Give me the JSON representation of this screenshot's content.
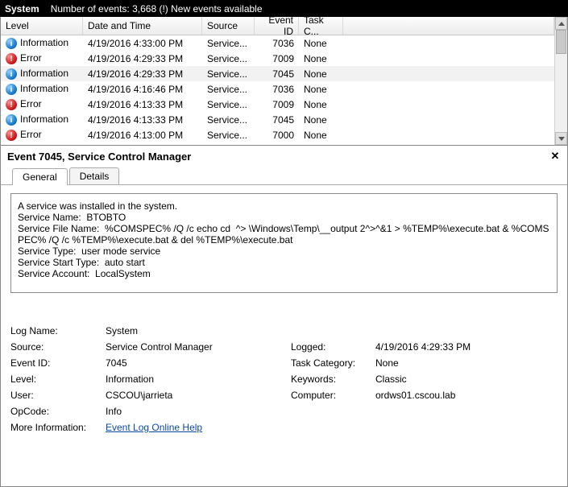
{
  "titlebar": {
    "title": "System",
    "right": "Number of events: 3,668 (!) New events available"
  },
  "columns": {
    "level": "Level",
    "datetime": "Date and Time",
    "source": "Source",
    "event_id": "Event ID",
    "task": "Task C..."
  },
  "events": [
    {
      "level": "Information",
      "icon": "info",
      "datetime": "4/19/2016 4:33:00 PM",
      "source": "Service...",
      "event_id": "7036",
      "task": "None",
      "selected": false
    },
    {
      "level": "Error",
      "icon": "err",
      "datetime": "4/19/2016 4:29:33 PM",
      "source": "Service...",
      "event_id": "7009",
      "task": "None",
      "selected": false
    },
    {
      "level": "Information",
      "icon": "info",
      "datetime": "4/19/2016 4:29:33 PM",
      "source": "Service...",
      "event_id": "7045",
      "task": "None",
      "selected": true
    },
    {
      "level": "Information",
      "icon": "info",
      "datetime": "4/19/2016 4:16:46 PM",
      "source": "Service...",
      "event_id": "7036",
      "task": "None",
      "selected": false
    },
    {
      "level": "Error",
      "icon": "err",
      "datetime": "4/19/2016 4:13:33 PM",
      "source": "Service...",
      "event_id": "7009",
      "task": "None",
      "selected": false
    },
    {
      "level": "Information",
      "icon": "info",
      "datetime": "4/19/2016 4:13:33 PM",
      "source": "Service...",
      "event_id": "7045",
      "task": "None",
      "selected": false
    },
    {
      "level": "Error",
      "icon": "err",
      "datetime": "4/19/2016 4:13:00 PM",
      "source": "Service...",
      "event_id": "7000",
      "task": "None",
      "selected": false
    }
  ],
  "detail": {
    "header": "Event 7045, Service Control Manager",
    "tabs": {
      "general": "General",
      "details": "Details"
    },
    "body_lines": [
      "A service was installed in the system.",
      "",
      "Service Name:  BTOBTO",
      "Service File Name:  %COMSPEC% /Q /c echo cd  ^> \\Windows\\Temp\\__output 2^>^&1 > %TEMP%\\execute.bat & %COMSPEC% /Q /c %TEMP%\\execute.bat & del %TEMP%\\execute.bat",
      "Service Type:  user mode service",
      "Service Start Type:  auto start",
      "Service Account:  LocalSystem"
    ],
    "labels": {
      "log_name": "Log Name:",
      "source": "Source:",
      "event_id": "Event ID:",
      "level": "Level:",
      "user": "User:",
      "opcode": "OpCode:",
      "logged": "Logged:",
      "task_category": "Task Category:",
      "keywords": "Keywords:",
      "computer": "Computer:",
      "more_info": "More Information:"
    },
    "values": {
      "log_name": "System",
      "source": "Service Control Manager",
      "event_id": "7045",
      "level": "Information",
      "user": "CSCOU\\jarrieta",
      "opcode": "Info",
      "logged": "4/19/2016 4:29:33 PM",
      "task_category": "None",
      "keywords": "Classic",
      "computer": "ordws01.cscou.lab"
    },
    "more_info_link": "Event Log Online Help"
  }
}
